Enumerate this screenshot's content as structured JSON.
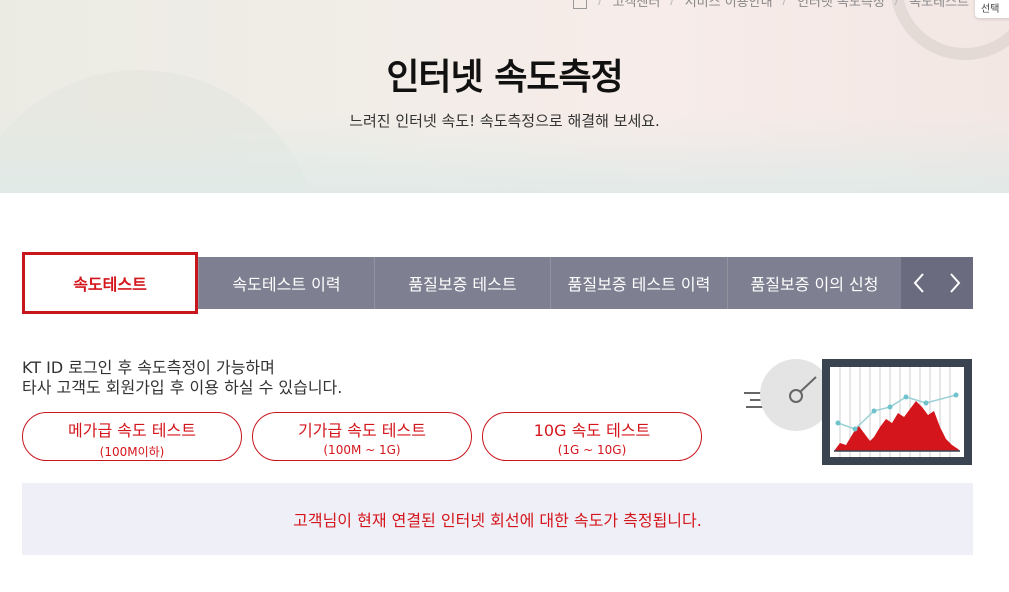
{
  "breadcrumb": {
    "items": [
      "고객센터",
      "서비스 이용안내",
      "인터넷 속도측정",
      "속도테스트"
    ]
  },
  "select_chip": "선택",
  "hero": {
    "title": "인터넷 속도측정",
    "subtitle": "느려진 인터넷 속도! 속도측정으로 해결해 보세요."
  },
  "tabs": {
    "items": [
      {
        "label": "속도테스트",
        "active": true
      },
      {
        "label": "속도테스트 이력",
        "active": false
      },
      {
        "label": "품질보증 테스트",
        "active": false
      },
      {
        "label": "품질보증 테스트 이력",
        "active": false
      },
      {
        "label": "품질보증 이의 신청",
        "active": false
      }
    ],
    "prev_icon": "chevron-left-icon",
    "next_icon": "chevron-right-icon"
  },
  "info": {
    "line1": "KT ID 로그인 후 속도측정이 가능하며",
    "line2": "타사 고객도 회원가입 후 이용 하실 수 있습니다."
  },
  "buttons": [
    {
      "label": "메가급 속도 테스트",
      "sub": "(100M이하)"
    },
    {
      "label": "기가급 속도 테스트",
      "sub": "(100M ~ 1G)"
    },
    {
      "label": "10G 속도 테스트",
      "sub": "(1G ~ 10G)"
    }
  ],
  "illustration": {
    "icon": "speed-gauge-monitor-icon"
  },
  "notice": "고객님이 현재 연결된 인터넷 회선에 대한 속도가 측정됩니다.",
  "colors": {
    "accent": "#d4161c",
    "tab_bg": "#7f7f92",
    "notice_bg": "#efeff7"
  }
}
